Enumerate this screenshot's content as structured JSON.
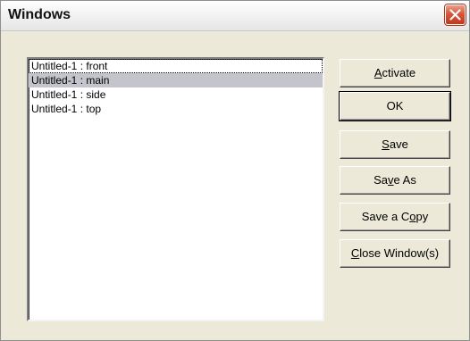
{
  "dialog": {
    "title": "Windows"
  },
  "list": {
    "items": [
      "Untitled-1 : front",
      "Untitled-1 : main",
      "Untitled-1 : side",
      "Untitled-1 : top"
    ],
    "selected_item": "Untitled-1 : main"
  },
  "buttons": {
    "activate": {
      "pre": "",
      "mn": "A",
      "post": "ctivate"
    },
    "ok": {
      "label": "OK"
    },
    "save": {
      "pre": "",
      "mn": "S",
      "post": "ave"
    },
    "save_as": {
      "pre": "Sa",
      "mn": "v",
      "post": "e As"
    },
    "save_copy": {
      "pre": "Save a C",
      "mn": "o",
      "post": "py"
    },
    "close_windows": {
      "pre": "",
      "mn": "C",
      "post": "lose Window(s)"
    }
  },
  "colors": {
    "selection": "#c4c4cc",
    "face": "#ece9d8",
    "close_red": "#d9563a"
  }
}
